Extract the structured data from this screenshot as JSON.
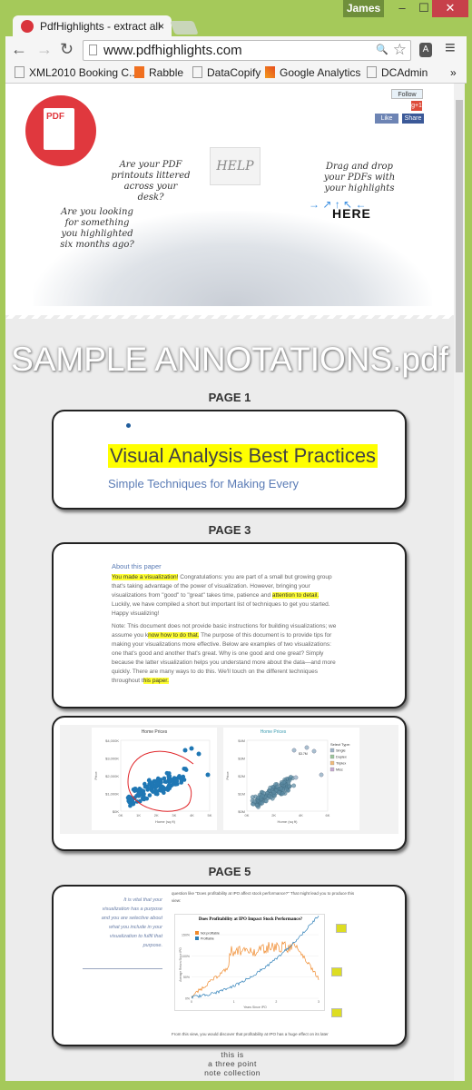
{
  "window": {
    "user": "James",
    "minimize": "–",
    "maximize": "☐",
    "close": "✕"
  },
  "tab": {
    "title": "PdfHighlights - extract all",
    "close": "×"
  },
  "toolbar": {
    "back": "←",
    "forward": "→",
    "reload": "↻",
    "url": "www.pdfhighlights.com",
    "zoom_icon": "🔍",
    "star": "☆",
    "menu": "≡",
    "ext": "A"
  },
  "bookmarks": [
    {
      "label": "XML2010 Booking C...",
      "icon": "page-icon"
    },
    {
      "label": "Rabble",
      "icon": "rabble-e-icon"
    },
    {
      "label": "DataCopify",
      "icon": "page-icon"
    },
    {
      "label": "Google Analytics",
      "icon": "analytics-icon"
    },
    {
      "label": "DCAdmin",
      "icon": "page-icon"
    }
  ],
  "bookmarks_more": "»",
  "hero": {
    "logo_text": "PDF",
    "q1": "Are your PDF printouts littered across your desk?",
    "q2": "Are you looking for something you highlighted six months ago?",
    "drop": "Drag and drop your PDFs with your highlights",
    "here": "HERE",
    "help": "HELP",
    "social": {
      "follow": "Follow",
      "gplus": "g+1",
      "like": "Like",
      "share": "Share"
    }
  },
  "doc_title": "SAMPLE ANNOTATIONS.pdf",
  "pages": [
    {
      "label": "PAGE 1",
      "heading": "Visual Analysis Best Practices",
      "subheading": "Simple Techniques for Making Every"
    },
    {
      "label": "PAGE 3",
      "section": "About this paper",
      "p1": [
        {
          "t": "You made a visualization!",
          "h": true
        },
        {
          "t": " Congratulations: you are part of a small but growing group that's taking advantage of the power of visualization. However, bringing your visualizations from \"good\" to \"great\" takes time, patience and "
        },
        {
          "t": "attention to detail.",
          "h": true
        },
        {
          "t": " Luckily, we have compiled a short but important list of techniques to get you started. Happy visualizing!"
        }
      ],
      "p2": [
        {
          "t": "Note: This document does not provide basic instructions for building visualizations; we assume you k"
        },
        {
          "t": "now how to do that.",
          "h": true
        },
        {
          "t": " The purpose of this document is to provide tips for making your visualizations more effective.   Below are examples of two visualizations: one that's good and another that's great. Why is one good and one great? Simply because the latter visualization helps you understand more about the data—and more quickly. There are many ways to do this. We'll touch on the different techniques throughout t"
        },
        {
          "t": "his paper.",
          "h": true
        }
      ],
      "chart_left": {
        "title": "Home Prices",
        "yticks": [
          "$4,000K",
          "$3,000K",
          "$2,000K",
          "$1,000K",
          "$0K"
        ],
        "xticks": [
          "0K",
          "1K",
          "2K",
          "3K",
          "4K",
          "5K"
        ],
        "xlabel": "Home (sq ft)",
        "ylabel": "Price"
      },
      "chart_right": {
        "title": "Home Prices",
        "yticks": [
          "$4M",
          "$3M",
          "$2M",
          "$1M",
          "$0M"
        ],
        "xticks": [
          "0K",
          "2K",
          "4K",
          "6K"
        ],
        "xlabel": "Home (sq ft)",
        "ylabel": "Price",
        "legend_title": "Select Type:",
        "legend": [
          {
            "name": "Single",
            "color": "#9fb4c8"
          },
          {
            "name": "Duplex",
            "color": "#9cc59c"
          },
          {
            "name": "Triplex",
            "color": "#f0b97a"
          },
          {
            "name": "Misc",
            "color": "#c6a9d1"
          }
        ],
        "annotation": "$3.7M"
      }
    },
    {
      "label": "PAGE 5",
      "side": "It is vital that your visualization has a purpose and you are selective about what you include in your visualization to fulfil that purpose.",
      "intro": "question like \"Does profitability at IPO affect stock performance?\" That might lead you to produce this view:",
      "chart_title": "Does Profitability at IPO Impact Stock Performance?",
      "legend": [
        {
          "name": "Not profitable",
          "color": "#f08a2c"
        },
        {
          "name": "Profitable",
          "color": "#2d7fb8"
        }
      ],
      "yticks": [
        "150%",
        "100%",
        "50%",
        "0%"
      ],
      "xticks": [
        "0",
        "1",
        "2",
        "3"
      ],
      "xlabel": "Years Since IPO",
      "ylabel": "Average Return Since IPO",
      "outro": "From this view, you would discover that profitability at IPO has a huge effect on its later"
    }
  ],
  "note_caption": [
    "this is",
    "a three point",
    "note collection"
  ]
}
